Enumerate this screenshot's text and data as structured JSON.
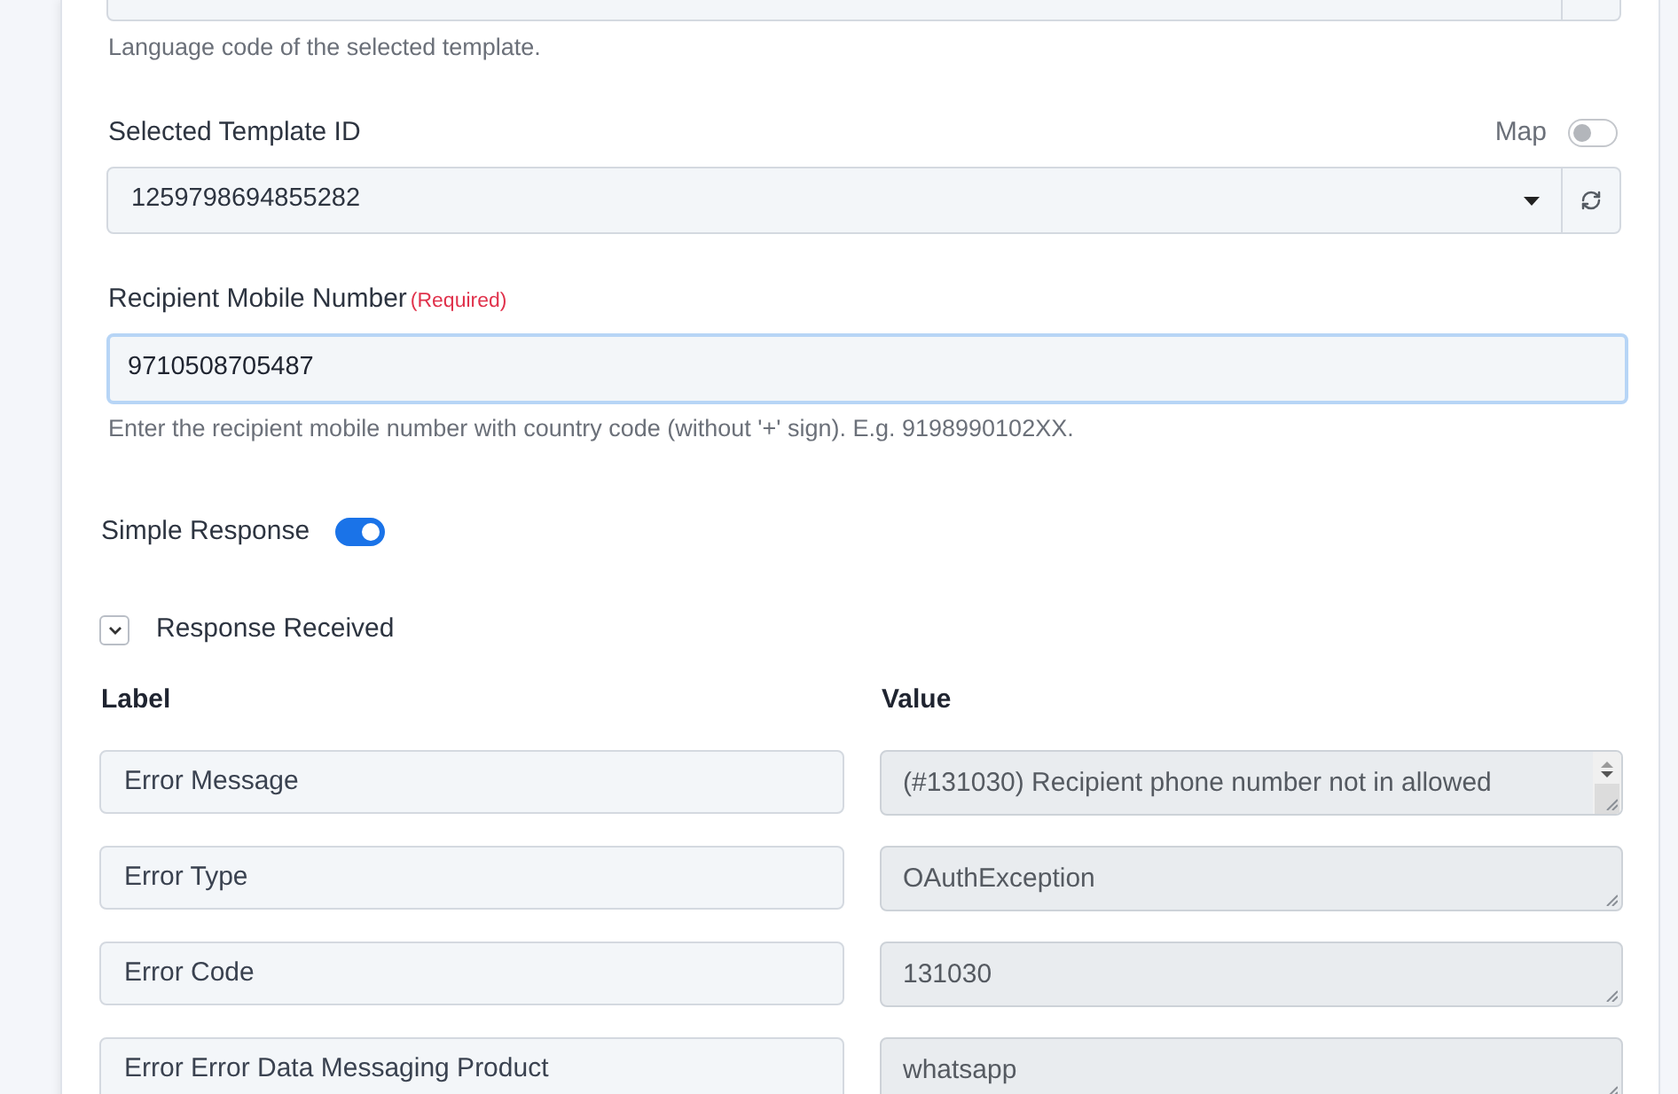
{
  "language_code": {
    "hint": "Language code of the selected template."
  },
  "template_id": {
    "label": "Selected Template ID",
    "map_label": "Map",
    "map_on": false,
    "value": "1259798694855282"
  },
  "recipient": {
    "label": "Recipient Mobile Number",
    "required_note": "(Required)",
    "value": "9710508705487",
    "focused": true,
    "hint": "Enter the recipient mobile number with country code (without '+' sign). E.g. 9198990102XX."
  },
  "simple_response": {
    "label": "Simple Response",
    "on": true
  },
  "response_received": {
    "title": "Response Received",
    "expanded": true,
    "columns": [
      "Label",
      "Value"
    ],
    "rows": [
      {
        "label": "Error Message",
        "value": "(#131030) Recipient phone number not in allowed",
        "scrollbar": true
      },
      {
        "label": "Error Type",
        "value": "OAuthException",
        "scrollbar": false
      },
      {
        "label": "Error Code",
        "value": "131030",
        "scrollbar": false
      },
      {
        "label": "Error Error Data Messaging Product",
        "value": "whatsapp",
        "scrollbar": false
      }
    ]
  }
}
